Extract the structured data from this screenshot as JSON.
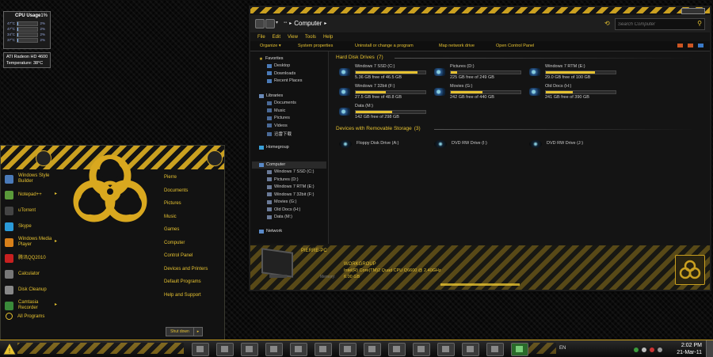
{
  "gadgets": {
    "cpu": {
      "title": "CPU Usage",
      "percent": "1%",
      "cores": [
        {
          "label": "47°C",
          "value": "2%",
          "level": 0.02
        },
        {
          "label": "47°C",
          "value": "2%",
          "level": 0.02
        },
        {
          "label": "34°C",
          "value": "2%",
          "level": 0.02
        },
        {
          "label": "37°C",
          "value": "2%",
          "level": 0.02
        }
      ]
    },
    "gpu": {
      "name": "ATI Radeon HD 4600",
      "temp_label": "Temperature:",
      "temp_value": "38°C"
    }
  },
  "start_menu": {
    "programs": [
      {
        "label": "Windows Style Builder",
        "color": "#4a7ab8",
        "has_arrow": false
      },
      {
        "label": "Notepad++",
        "color": "#5a9a3a",
        "has_arrow": true
      },
      {
        "label": "uTorrent",
        "color": "#444444",
        "has_arrow": false
      },
      {
        "label": "Skype",
        "color": "#2a9ad8",
        "has_arrow": false
      },
      {
        "label": "Windows Media Player",
        "color": "#d8801a",
        "has_arrow": true
      },
      {
        "label": "腾讯QQ2010",
        "color": "#c82020",
        "has_arrow": false
      },
      {
        "label": "Calculator",
        "color": "#777777",
        "has_arrow": false
      },
      {
        "label": "Disk Cleanup",
        "color": "#888888",
        "has_arrow": false
      },
      {
        "label": "Camtasia Recorder",
        "color": "#3a8a3a",
        "has_arrow": true
      }
    ],
    "all_programs": "All Programs",
    "right_links": [
      "Pierre",
      "Documents",
      "Pictures",
      "Music",
      "Games",
      "Computer",
      "Control Panel",
      "Devices and Printers",
      "Default Programs",
      "Help and Support"
    ],
    "shutdown_label": "Shut down",
    "shutdown_arrow": "▸"
  },
  "explorer": {
    "address": {
      "icon": "▪▪",
      "sep1": "▸",
      "location": "Computer",
      "sep2": "▸"
    },
    "search_placeholder": "Search Computer",
    "menu": [
      "File",
      "Edit",
      "View",
      "Tools",
      "Help"
    ],
    "commands": [
      "Organize ▾",
      "System properties",
      "Uninstall or change a program",
      "Map network drive",
      "Open Control Panel"
    ],
    "nav": {
      "favorites": "Favorites",
      "fav_items": [
        "Desktop",
        "Downloads",
        "Recent Places"
      ],
      "libraries": "Libraries",
      "lib_items": [
        "Documents",
        "Music",
        "Pictures",
        "Videos",
        "迅雷下载"
      ],
      "homegroup": "Homegroup",
      "computer": "Computer",
      "comp_items": [
        "Windows 7 SSD (C:)",
        "Pictures (D:)",
        "Windows 7 RTM (E:)",
        "Windows 7 32bit (F:)",
        "Movies (G:)",
        "Old Docs (H:)",
        "Data (M:)"
      ],
      "network": "Network"
    },
    "hdd_group": {
      "title": "Hard Disk Drives",
      "count": "(7)"
    },
    "drives": [
      {
        "name": "Windows 7 SSD (C:)",
        "free": "5.36 GB free of 46.5 GB",
        "used": 0.885
      },
      {
        "name": "Pictures (D:)",
        "free": "225 GB free of 249 GB",
        "used": 0.096
      },
      {
        "name": "Windows 7 RTM (E:)",
        "free": "29.0 GB free of 100 GB",
        "used": 0.71
      },
      {
        "name": "Windows 7 32bit (F:)",
        "free": "27.5 GB free of 48.8 GB",
        "used": 0.436
      },
      {
        "name": "Movies (G:)",
        "free": "242 GB free of 440 GB",
        "used": 0.45
      },
      {
        "name": "Old Docs (H:)",
        "free": "241 GB free of 390 GB",
        "used": 0.382
      },
      {
        "name": "Data (M:)",
        "free": "142 GB free of 298 GB",
        "used": 0.523
      }
    ],
    "removable_group": {
      "title": "Devices with Removable Storage",
      "count": "(3)"
    },
    "removable": [
      "Floppy Disk Drive (A:)",
      "DVD RW Drive (I:)",
      "DVD RW Drive (J:)"
    ],
    "details": {
      "pc_name": "PIERRE-PC",
      "workgroup": "WORKGROUP",
      "processor": "Intel(R) Core(TM)2 Quad CPU    Q6600  @ 2.40GHz",
      "memory_label": "Memory:",
      "memory": "6.00 GB"
    }
  },
  "taskbar": {
    "language": "EN",
    "time": "2:02 PM",
    "date": "21-Mar-11"
  },
  "colors": {
    "accent": "#e6c230",
    "hazard_dark": "#141414"
  }
}
